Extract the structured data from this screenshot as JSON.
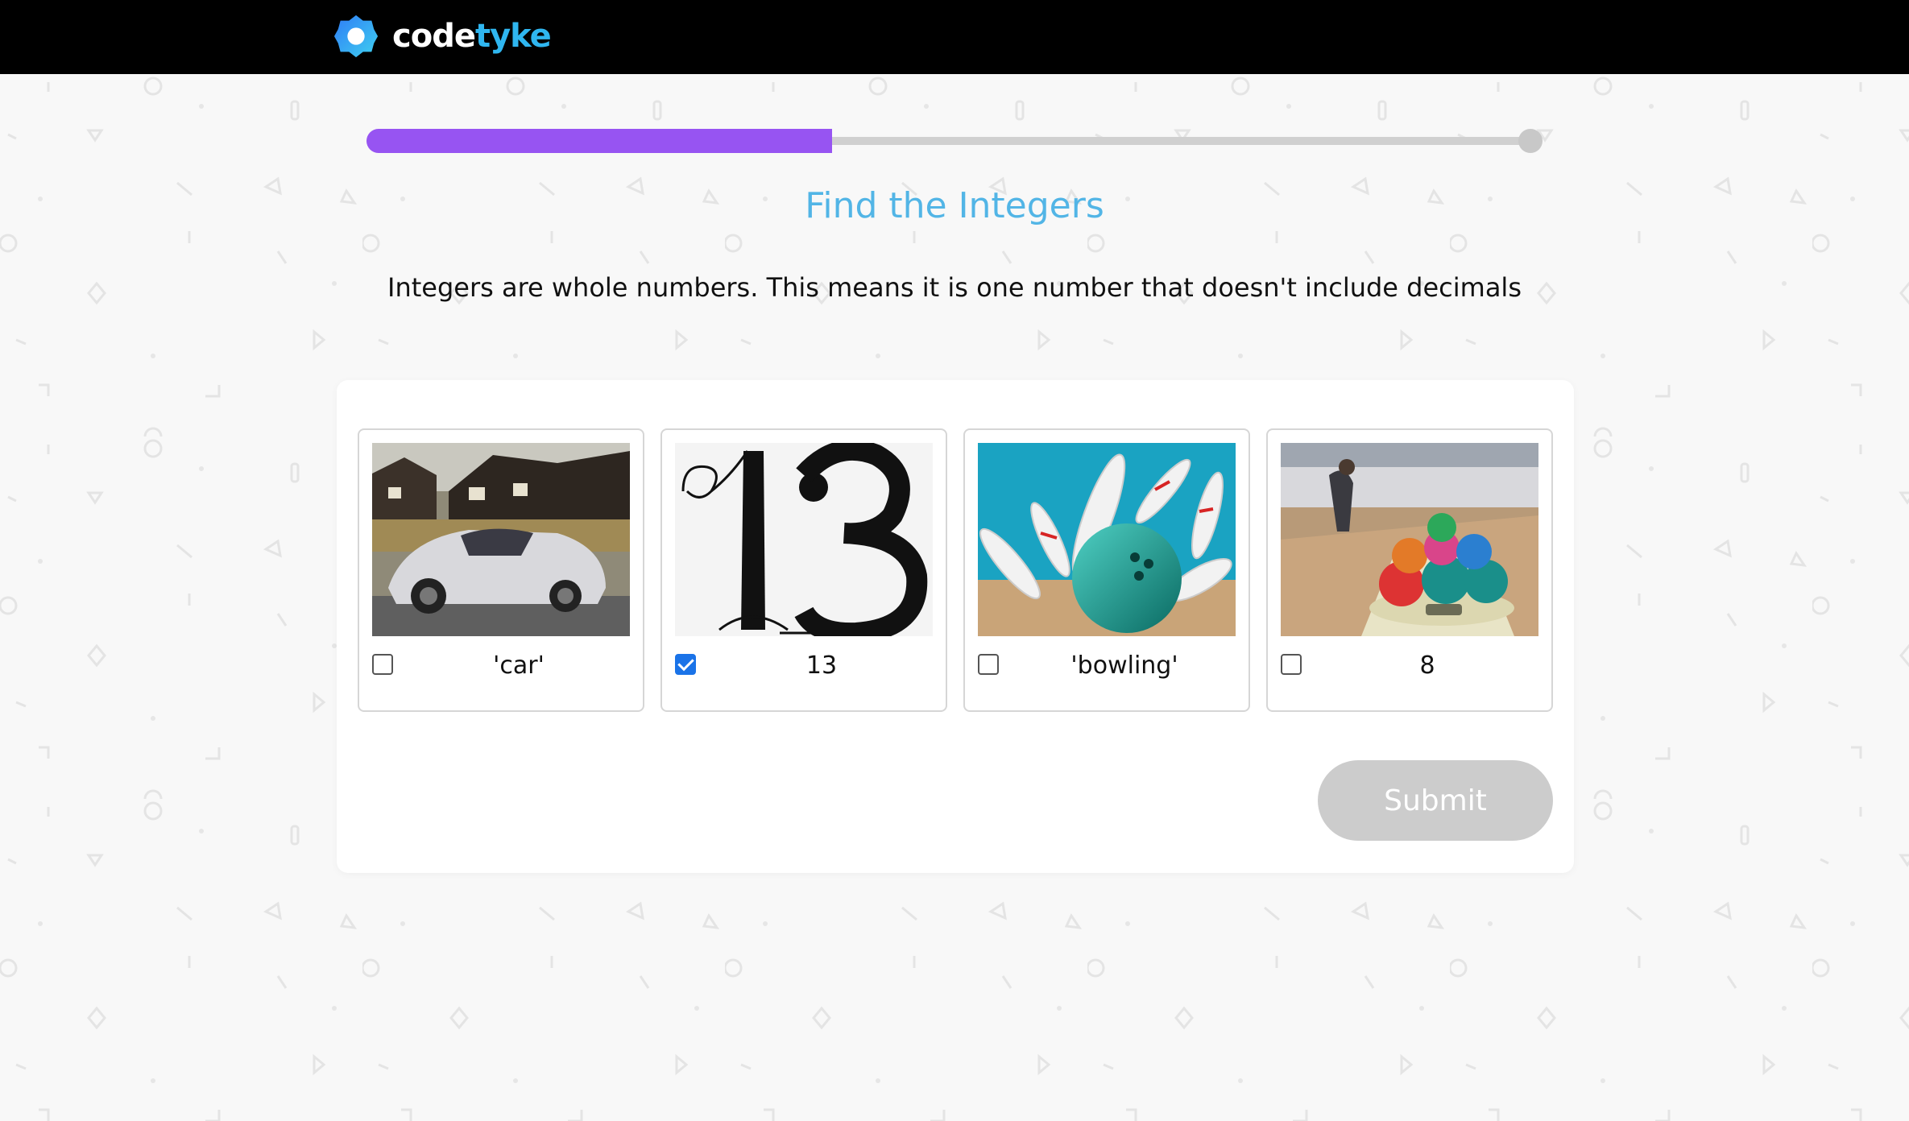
{
  "header": {
    "brand_part1": "code",
    "brand_part2": "tyke",
    "logo_icon": "codetyke-hexagon-logo-icon",
    "colors": {
      "background": "#000000",
      "brand_accent": "#2fb6f0"
    }
  },
  "progress": {
    "value_fraction": 0.4,
    "fill_color": "#9754f2",
    "track_color": "#d0d0d0"
  },
  "quiz": {
    "title": "Find the Integers",
    "instructions": "Integers are whole numbers. This means it is one number that doesn't include decimals",
    "title_color": "#52b5e6"
  },
  "options": [
    {
      "label": "'car'",
      "checked": false,
      "image": "sports-car-photo"
    },
    {
      "label": "13",
      "checked": true,
      "image": "number-13-typography"
    },
    {
      "label": "'bowling'",
      "checked": false,
      "image": "bowling-pins-photo"
    },
    {
      "label": "8",
      "checked": false,
      "image": "bowling-ball-return-photo"
    }
  ],
  "submit": {
    "label": "Submit",
    "disabled": true,
    "color": "#cccccc"
  }
}
